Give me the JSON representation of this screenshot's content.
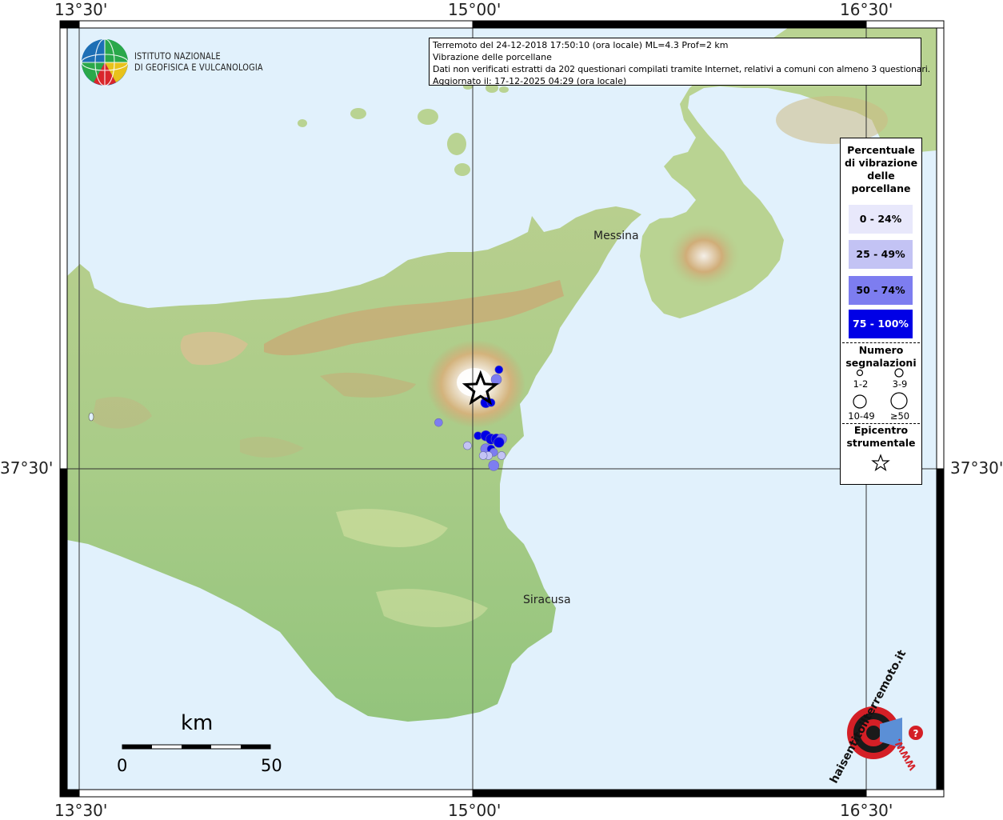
{
  "coords": {
    "top": [
      "13°30'",
      "15°00'",
      "16°30'"
    ],
    "bottom": [
      "13°30'",
      "15°00'",
      "16°30'"
    ],
    "left": "37°30'",
    "right": "37°30'"
  },
  "logo": {
    "line1": "ISTITUTO NAZIONALE",
    "line2": "DI GEOFISICA E VULCANOLOGIA"
  },
  "info": {
    "line1": "Terremoto del 24-12-2018 17:50:10 (ora locale) ML=4.3 Prof=2 km",
    "line2": "Vibrazione delle porcellane",
    "line3": "Dati non verificati estratti da 202 questionari compilati tramite Internet, relativi a comuni con almeno 3 questionari.",
    "line4": "Aggiornato il: 17-12-2025 04:29 (ora locale)"
  },
  "legend": {
    "title_lines": [
      "Percentuale",
      "di vibrazione",
      "delle",
      "porcellane"
    ],
    "classes": [
      {
        "label": "0 - 24%",
        "color": "#e8e8fb",
        "text_color": "#000"
      },
      {
        "label": "25 - 49%",
        "color": "#c3c3f4",
        "text_color": "#000"
      },
      {
        "label": "50 - 74%",
        "color": "#7d7df0",
        "text_color": "#000"
      },
      {
        "label": "75 - 100%",
        "color": "#0000e6",
        "text_color": "#fff"
      }
    ],
    "count_title_lines": [
      "Numero",
      "segnalazioni"
    ],
    "count_classes": [
      "1-2",
      "3-9",
      "10-49",
      "≥50"
    ],
    "epicenter_title_lines": [
      "Epicentro",
      "strumentale"
    ]
  },
  "places": {
    "messina": "Messina",
    "siracusa": "Siracusa"
  },
  "scale": {
    "unit": "km",
    "min": "0",
    "max": "50"
  },
  "brand": {
    "text": "haisentitoilterremoto.it",
    "url": "WWW."
  },
  "colors": {
    "sea": "#e1f1fc",
    "frame": "#000000"
  },
  "markers": [
    {
      "lon": 15.1,
      "lat": 37.8,
      "class": 3,
      "size": 1
    },
    {
      "lon": 15.09,
      "lat": 37.77,
      "class": 2,
      "size": 2
    },
    {
      "lon": 15.05,
      "lat": 37.7,
      "class": 3,
      "size": 2
    },
    {
      "lon": 15.07,
      "lat": 37.7,
      "class": 3,
      "size": 1
    },
    {
      "lon": 14.87,
      "lat": 37.64,
      "class": 2,
      "size": 1
    },
    {
      "lon": 15.02,
      "lat": 37.6,
      "class": 3,
      "size": 1
    },
    {
      "lon": 15.05,
      "lat": 37.6,
      "class": 3,
      "size": 2
    },
    {
      "lon": 15.07,
      "lat": 37.59,
      "class": 3,
      "size": 2
    },
    {
      "lon": 15.09,
      "lat": 37.59,
      "class": 3,
      "size": 2
    },
    {
      "lon": 15.11,
      "lat": 37.59,
      "class": 2,
      "size": 2
    },
    {
      "lon": 15.1,
      "lat": 37.58,
      "class": 3,
      "size": 2
    },
    {
      "lon": 14.98,
      "lat": 37.57,
      "class": 1,
      "size": 1
    },
    {
      "lon": 15.05,
      "lat": 37.56,
      "class": 2,
      "size": 2
    },
    {
      "lon": 15.07,
      "lat": 37.56,
      "class": 3,
      "size": 1
    },
    {
      "lon": 15.08,
      "lat": 37.55,
      "class": 2,
      "size": 1
    },
    {
      "lon": 15.06,
      "lat": 37.54,
      "class": 1,
      "size": 1
    },
    {
      "lon": 15.04,
      "lat": 37.54,
      "class": 1,
      "size": 1
    },
    {
      "lon": 15.11,
      "lat": 37.54,
      "class": 1,
      "size": 1
    },
    {
      "lon": 15.08,
      "lat": 37.51,
      "class": 2,
      "size": 2
    }
  ],
  "epicenter": {
    "lon": 15.03,
    "lat": 37.74
  }
}
